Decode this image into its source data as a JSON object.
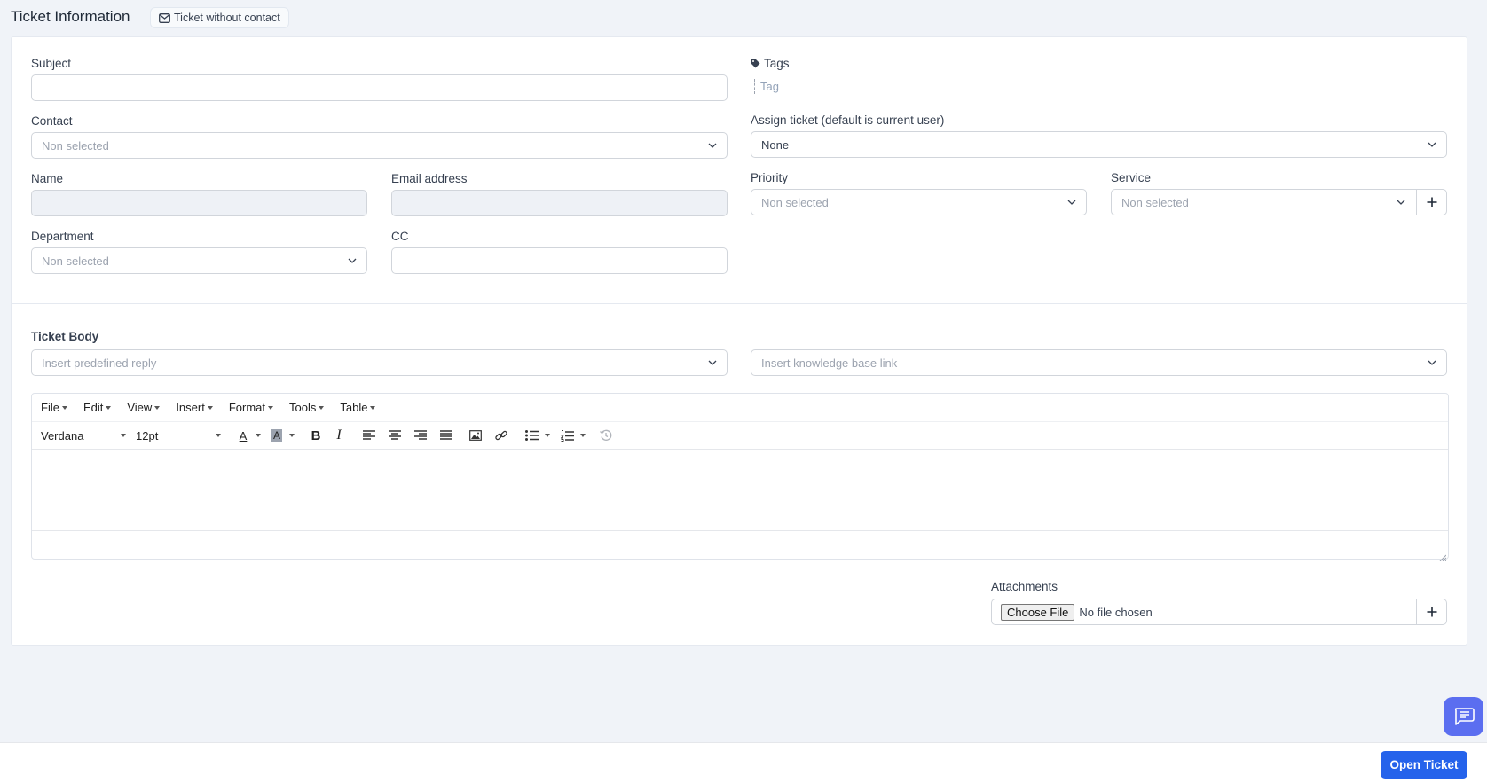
{
  "header": {
    "title": "Ticket Information",
    "badge_label": "Ticket without contact"
  },
  "form": {
    "subject": {
      "label": "Subject",
      "value": ""
    },
    "contact": {
      "label": "Contact",
      "placeholder": "Non selected"
    },
    "name": {
      "label": "Name",
      "value": ""
    },
    "email": {
      "label": "Email address",
      "value": ""
    },
    "department": {
      "label": "Department",
      "placeholder": "Non selected"
    },
    "cc": {
      "label": "CC",
      "value": ""
    },
    "tags": {
      "label": "Tags",
      "placeholder": "Tag"
    },
    "assign": {
      "label": "Assign ticket (default is current user)",
      "value": "None"
    },
    "priority": {
      "label": "Priority",
      "placeholder": "Non selected"
    },
    "service": {
      "label": "Service",
      "placeholder": "Non selected"
    }
  },
  "body": {
    "label": "Ticket Body",
    "predefined_reply_placeholder": "Insert predefined reply",
    "kb_link_placeholder": "Insert knowledge base link"
  },
  "editor": {
    "menus": [
      "File",
      "Edit",
      "View",
      "Insert",
      "Format",
      "Tools",
      "Table"
    ],
    "font_family": "Verdana",
    "font_size": "12pt",
    "bold_glyph": "B",
    "italic_glyph": "I",
    "text_color_glyph": "A",
    "bg_color_glyph": "A"
  },
  "attachments": {
    "label": "Attachments",
    "choose_file_label": "Choose File",
    "no_file_text": "No file chosen"
  },
  "footer": {
    "submit_label": "Open Ticket"
  },
  "colors": {
    "primary": "#2563eb",
    "chat": "#5b6ef0",
    "page_bg": "#f0f3f8"
  }
}
